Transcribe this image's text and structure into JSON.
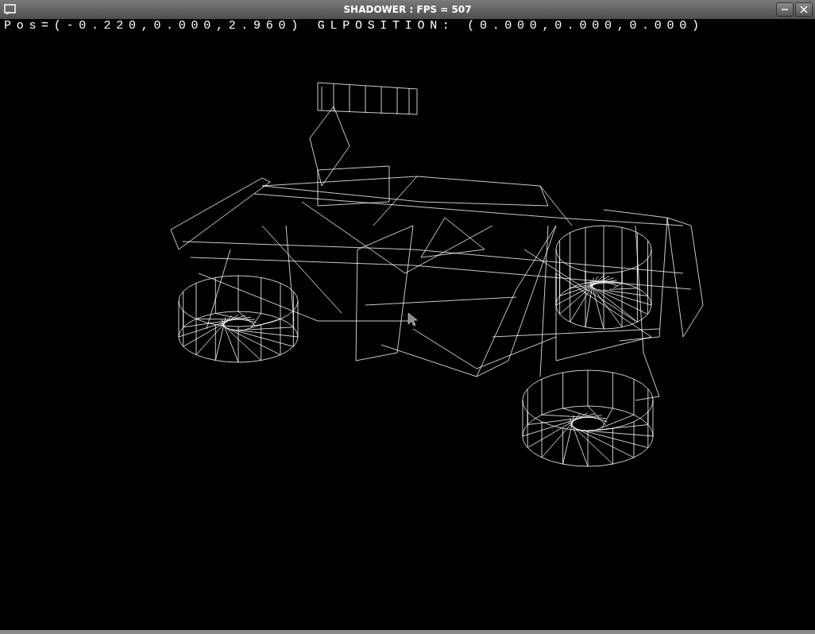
{
  "window": {
    "title": "SHADOWER : FPS = 507"
  },
  "overlay": {
    "position": "Pos=(-0.220,0.000,2.960)",
    "gl_position": "GLPOSITION: (0.000,0.000,0.000)"
  }
}
